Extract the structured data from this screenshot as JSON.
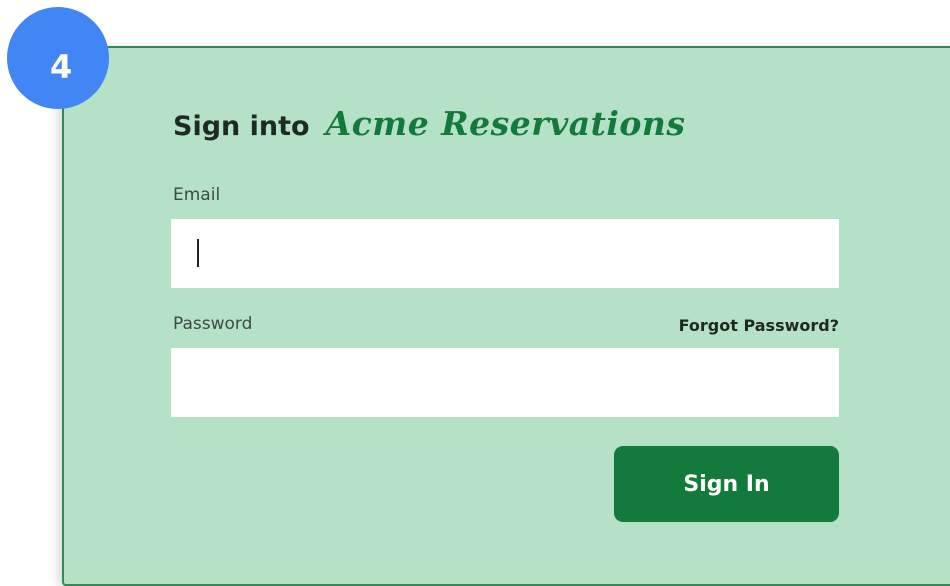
{
  "step_badge": "4",
  "form": {
    "title_prefix": "Sign into",
    "title_brand": "Acme Reservations",
    "email_label": "Email",
    "email_value": "",
    "password_label": "Password",
    "password_value": "",
    "forgot_link": "Forgot Password?",
    "submit_label": "Sign In"
  },
  "colors": {
    "panel_bg": "#b5e2c7",
    "panel_border": "#2f8a55",
    "brand_green": "#137a3b",
    "badge_blue": "#4285f4"
  }
}
